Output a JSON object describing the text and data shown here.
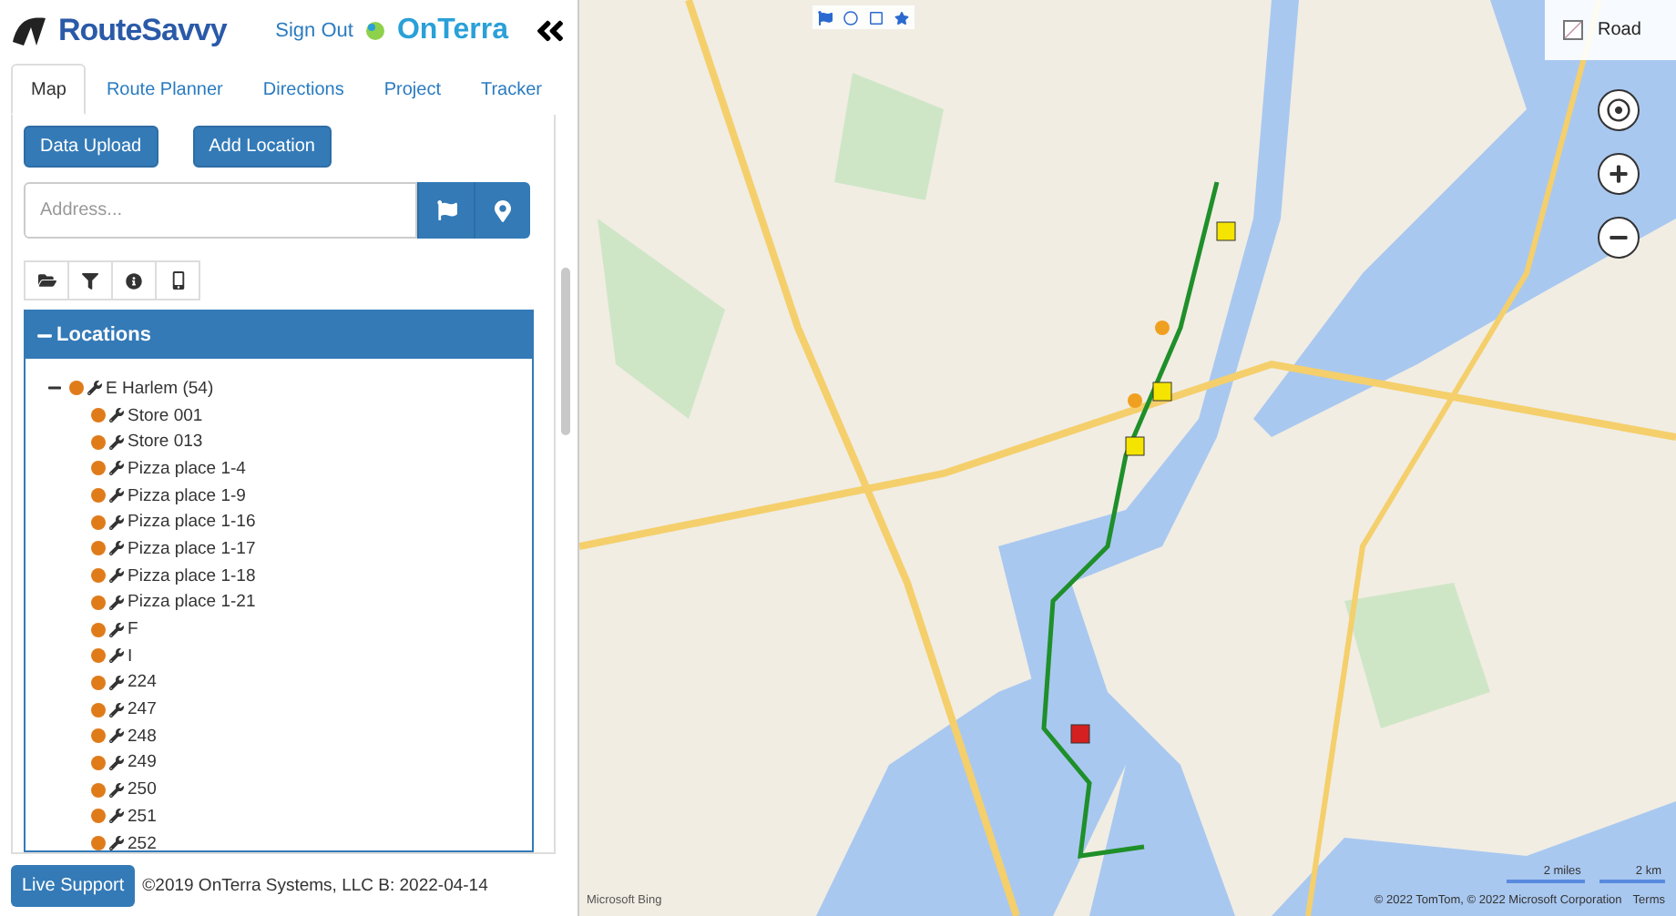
{
  "header": {
    "brand": "RouteSavvy",
    "sign_out": "Sign Out",
    "partner": "OnTerra"
  },
  "tabs": [
    {
      "label": "Map",
      "selected": true
    },
    {
      "label": "Route Planner",
      "selected": false
    },
    {
      "label": "Directions",
      "selected": false
    },
    {
      "label": "Project",
      "selected": false
    },
    {
      "label": "Tracker",
      "selected": false
    }
  ],
  "buttons": [
    "Data Upload",
    "Add Location"
  ],
  "address": {
    "placeholder": "Address..."
  },
  "locations": {
    "title": "Locations",
    "expanded": true,
    "tree": [
      {
        "label": "E Harlem (54)",
        "expanded": true,
        "children": [
          {
            "label": "Store 001"
          },
          {
            "label": "Store 013"
          },
          {
            "label": "Pizza place 1-4"
          },
          {
            "label": "Pizza place 1-9"
          },
          {
            "label": "Pizza place 1-16"
          },
          {
            "label": "Pizza place 1-17"
          },
          {
            "label": "Pizza place 1-18"
          },
          {
            "label": "Pizza place 1-21"
          },
          {
            "label": "F"
          },
          {
            "label": "I"
          },
          {
            "label": "224"
          },
          {
            "label": "247"
          },
          {
            "label": "248"
          },
          {
            "label": "249"
          },
          {
            "label": "250"
          },
          {
            "label": "251"
          },
          {
            "label": "252"
          }
        ]
      }
    ]
  },
  "footer": {
    "button": "Live Support",
    "copyright": "©2019 OnTerra Systems, LLC B: 2022-04-14"
  },
  "map": {
    "kind": "picture",
    "style_button": "Road",
    "scale": [
      "2 miles",
      "2 km"
    ],
    "attribution": "© 2022 TomTom, © 2022 Microsoft Corporation",
    "terms": "Terms",
    "logo": "Microsoft Bing"
  }
}
